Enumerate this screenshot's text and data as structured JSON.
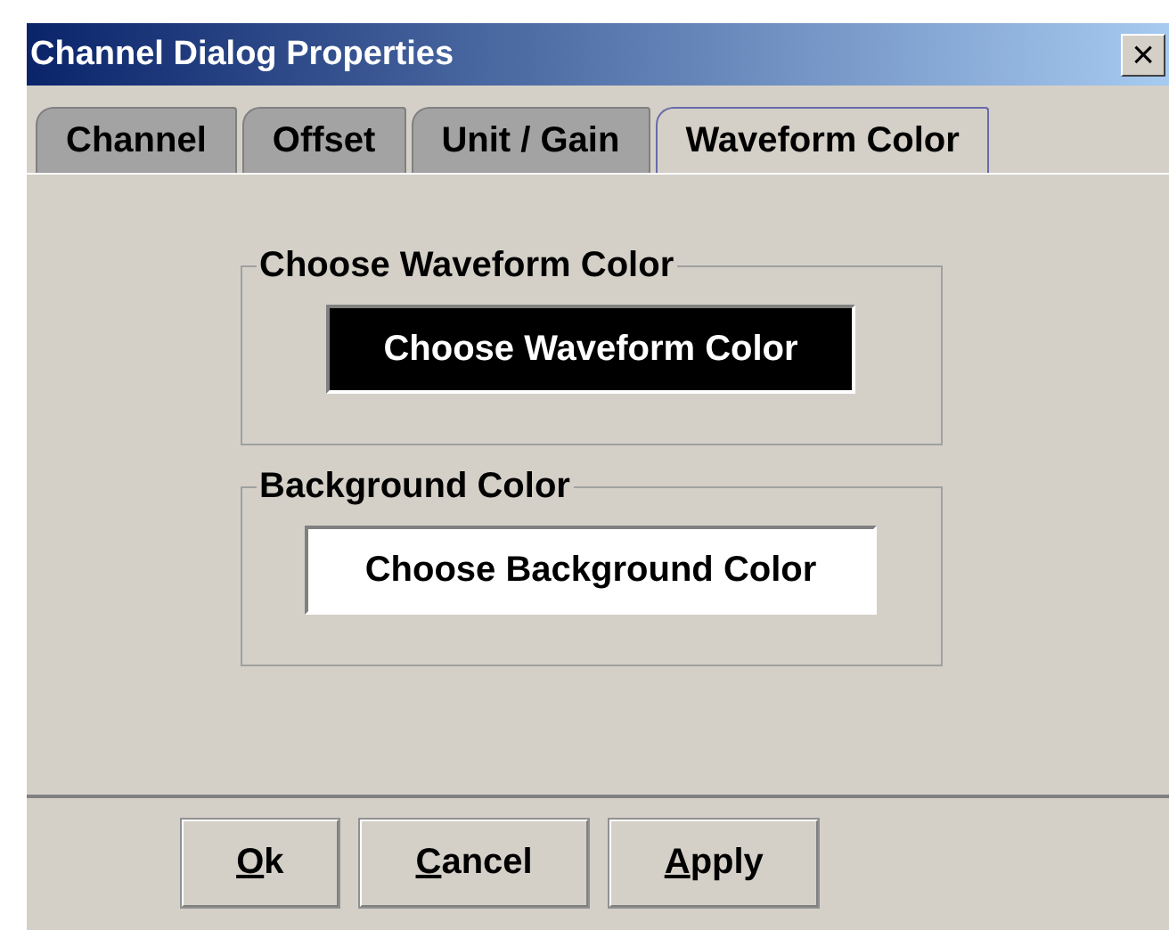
{
  "window": {
    "title": "Channel Dialog Properties",
    "close": "×"
  },
  "tabs": [
    {
      "label": "Channel",
      "selected": false
    },
    {
      "label": "Offset",
      "selected": false
    },
    {
      "label": "Unit / Gain",
      "selected": false
    },
    {
      "label": "Waveform Color",
      "selected": true
    }
  ],
  "groups": [
    {
      "title": "Choose Waveform Color",
      "button": "Choose Waveform Color",
      "color": "#000000"
    },
    {
      "title": "Background Color",
      "button": "Choose Background Color",
      "color": "#ffffff"
    }
  ],
  "buttons": [
    "Ok",
    "Cancel",
    "Apply"
  ]
}
